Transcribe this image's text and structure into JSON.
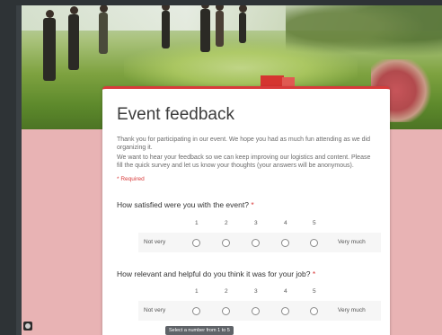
{
  "form": {
    "title": "Event feedback",
    "description_1": "Thank you for participating in our event. We hope you had as much fun attending as we did organizing it.",
    "description_2": "We want to hear your feedback so we can keep improving our logistics and content. Please fill the quick survey and let us know your thoughts (your answers will be anonymous).",
    "required_note": "* Required"
  },
  "questions": [
    {
      "label": "How satisfied were you with the event?",
      "required_mark": "*",
      "scale": [
        "1",
        "2",
        "3",
        "4",
        "5"
      ],
      "low_label": "Not very",
      "high_label": "Very much"
    },
    {
      "label": "How relevant and helpful do you think it was for your job?",
      "required_mark": "*",
      "scale": [
        "1",
        "2",
        "3",
        "4",
        "5"
      ],
      "low_label": "Not very",
      "high_label": "Very much"
    }
  ],
  "tooltip": "Select a number from 1 to 5",
  "icons": {
    "help": "help-icon"
  },
  "colors": {
    "accent": "#d93b3b",
    "page_background": "#e8b3b4"
  }
}
